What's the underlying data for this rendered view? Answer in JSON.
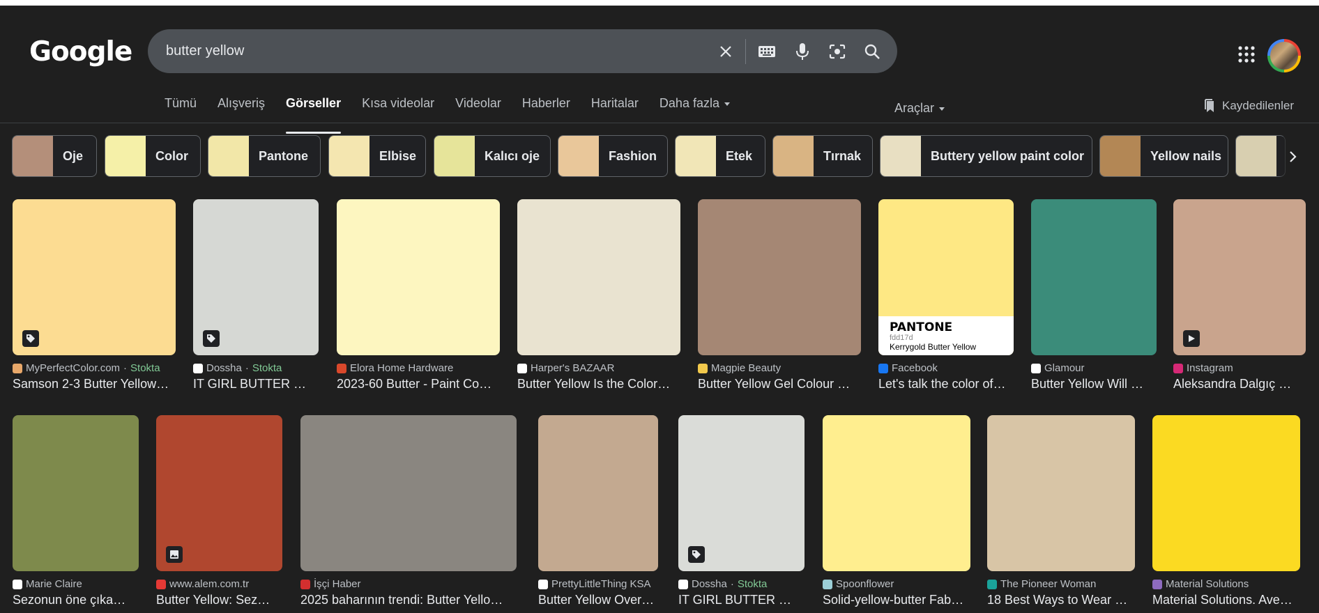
{
  "header": {
    "logo": "Google",
    "search_value": "butter yellow",
    "icons": [
      "close-icon",
      "keyboard-icon",
      "microphone-icon",
      "lens-icon",
      "search-icon"
    ]
  },
  "tabs": [
    {
      "label": "Tümü"
    },
    {
      "label": "Alışveriş"
    },
    {
      "label": "Görseller",
      "active": true
    },
    {
      "label": "Kısa videolar"
    },
    {
      "label": "Videolar"
    },
    {
      "label": "Haberler"
    },
    {
      "label": "Haritalar"
    },
    {
      "label": "Daha fazla",
      "dropdown": true
    }
  ],
  "tools_label": "Araçlar",
  "saved_label": "Kaydedilenler",
  "chips": [
    {
      "label": "Oje",
      "color": "#b48f7a"
    },
    {
      "label": "Color",
      "color": "#f5f0a8"
    },
    {
      "label": "Pantone",
      "color": "#f2e7a8"
    },
    {
      "label": "Elbise",
      "color": "#f4e6b0"
    },
    {
      "label": "Kalıcı oje",
      "color": "#e6e49a"
    },
    {
      "label": "Fashion",
      "color": "#e9c79a"
    },
    {
      "label": "Etek",
      "color": "#f1e6b7"
    },
    {
      "label": "Tırnak",
      "color": "#d9b483"
    },
    {
      "label": "Buttery yellow paint color",
      "color": "#e8dfc2"
    },
    {
      "label": "Yellow nails",
      "color": "#b38755"
    },
    {
      "label": "",
      "color": "#d8cfb0"
    }
  ],
  "row1": [
    {
      "source": "MyPerfectColor.com",
      "stock": "Stokta",
      "title": "Samson 2-3 Butter Yellow…",
      "bg": "#fcdc92",
      "fav": "#e8a86a",
      "badge": "tag-icon"
    },
    {
      "source": "Dossha",
      "stock": "Stokta",
      "title": "IT GIRL BUTTER …",
      "bg": "#d6d8d4",
      "fav": "#ffffff",
      "badge": "tag-icon"
    },
    {
      "source": "Elora Home Hardware",
      "title": "2023-60 Butter - Paint Co…",
      "bg": "#fdf6c0",
      "fav": "#d9482b"
    },
    {
      "source": "Harper's BAZAAR",
      "title": "Butter Yellow Is the Color…",
      "bg": "#e9e3d0",
      "fav": "#ffffff"
    },
    {
      "source": "Magpie Beauty",
      "title": "Butter Yellow Gel Colour …",
      "bg": "#a58774",
      "fav": "#f2c94c"
    },
    {
      "source": "Facebook",
      "title": "Let's talk the color of…",
      "bg": "#fee884",
      "fav": "#1877f2",
      "pantone": {
        "name": "PANTONE",
        "code": "fdd17d",
        "sub": "Kerrygold Butter Yellow"
      }
    },
    {
      "source": "Glamour",
      "title": "Butter Yellow Will …",
      "bg": "#3b8c7a",
      "fav": "#ffffff"
    },
    {
      "source": "Instagram",
      "title": "Aleksandra Dalgıç …",
      "bg": "#c9a48d",
      "fav": "#d62976",
      "badge": "play-icon"
    }
  ],
  "row2": [
    {
      "source": "Marie Claire",
      "title": "Sezonun öne çıka…",
      "bg": "#7e8a4c",
      "fav": "#ffffff"
    },
    {
      "source": "www.alem.com.tr",
      "title": "Butter Yellow: Sez…",
      "bg": "#b0472f",
      "fav": "#e53935",
      "badge": "image-icon"
    },
    {
      "source": "İşçi Haber",
      "title": "2025 baharının trendi: Butter Yello…",
      "bg": "#8a8680",
      "fav": "#d32f2f"
    },
    {
      "source": "PrettyLittleThing KSA",
      "title": "Butter Yellow Over…",
      "bg": "#c3a990",
      "fav": "#ffffff"
    },
    {
      "source": "Dossha",
      "stock": "Stokta",
      "title": "IT GIRL BUTTER …",
      "bg": "#dadcd8",
      "fav": "#ffffff",
      "badge": "tag-icon"
    },
    {
      "source": "Spoonflower",
      "title": "Solid-yellow-butter Fab…",
      "bg": "#ffee8f",
      "fav": "#9ccfd8"
    },
    {
      "source": "The Pioneer Woman",
      "title": "18 Best Ways to Wear …",
      "bg": "#d8c5a6",
      "fav": "#1aa39a"
    },
    {
      "source": "Material Solutions",
      "title": "Material Solutions. Ave…",
      "bg": "#fbda22",
      "fav": "#8e6bbf"
    }
  ]
}
